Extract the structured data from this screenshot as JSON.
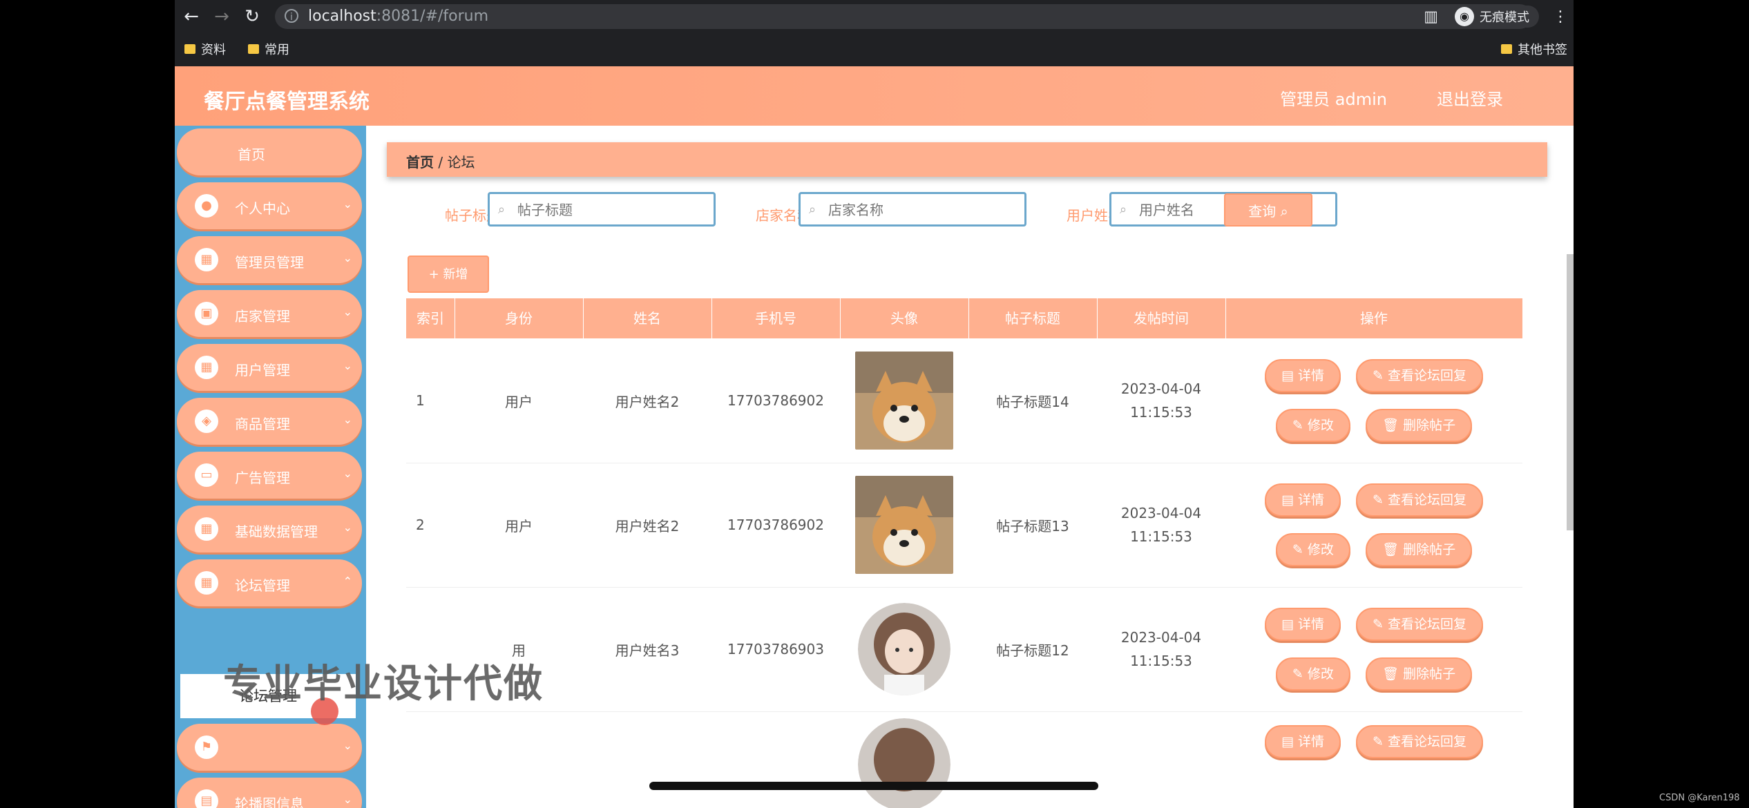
{
  "browser": {
    "url_host": "localhost",
    "url_rest": ":8081/#/forum",
    "incognito_label": "无痕模式",
    "bookmarks": [
      "资料",
      "常用"
    ],
    "other_bookmarks": "其他书签"
  },
  "header": {
    "app_title": "餐厅点餐管理系统",
    "admin_label": "管理员 admin",
    "logout_label": "退出登录"
  },
  "sidebar": {
    "items": [
      {
        "label": "首页"
      },
      {
        "label": "个人中心"
      },
      {
        "label": "管理员管理"
      },
      {
        "label": "店家管理"
      },
      {
        "label": "用户管理"
      },
      {
        "label": "商品管理"
      },
      {
        "label": "广告管理"
      },
      {
        "label": "基础数据管理"
      },
      {
        "label": "论坛管理"
      },
      {
        "label": ""
      },
      {
        "label": "轮播图信息"
      }
    ],
    "active_submenu": "论坛管理"
  },
  "breadcrumb": {
    "home": "首页",
    "sep": "/",
    "current": "论坛"
  },
  "filters": {
    "title_label": "帖子标题",
    "title_placeholder": "帖子标题",
    "shop_label": "店家名称",
    "shop_placeholder": "店家名称",
    "user_label": "用户姓名",
    "user_placeholder": "用户姓名",
    "query_button": "查询"
  },
  "add_button": "+ 新增",
  "table": {
    "headers": [
      "索引",
      "身份",
      "姓名",
      "手机号",
      "头像",
      "帖子标题",
      "发帖时间",
      "操作"
    ],
    "rows": [
      {
        "index": "1",
        "identity": "用户",
        "name": "用户姓名2",
        "phone": "17703786902",
        "title": "帖子标题14",
        "time": "2023-04-04 11:15:53",
        "avatar": "dog"
      },
      {
        "index": "2",
        "identity": "用户",
        "name": "用户姓名2",
        "phone": "17703786902",
        "title": "帖子标题13",
        "time": "2023-04-04 11:15:53",
        "avatar": "dog"
      },
      {
        "index": "",
        "identity": "用",
        "name": "用户姓名3",
        "phone": "17703786903",
        "title": "帖子标题12",
        "time": "2023-04-04 11:15:53",
        "avatar": "girl"
      }
    ],
    "ops": {
      "detail": "详情",
      "view_reply": "查看论坛回复",
      "edit": "修改",
      "delete": "删除帖子"
    }
  },
  "overlay_text": "专业毕业设计代做",
  "credit": "CSDN @Karen198"
}
